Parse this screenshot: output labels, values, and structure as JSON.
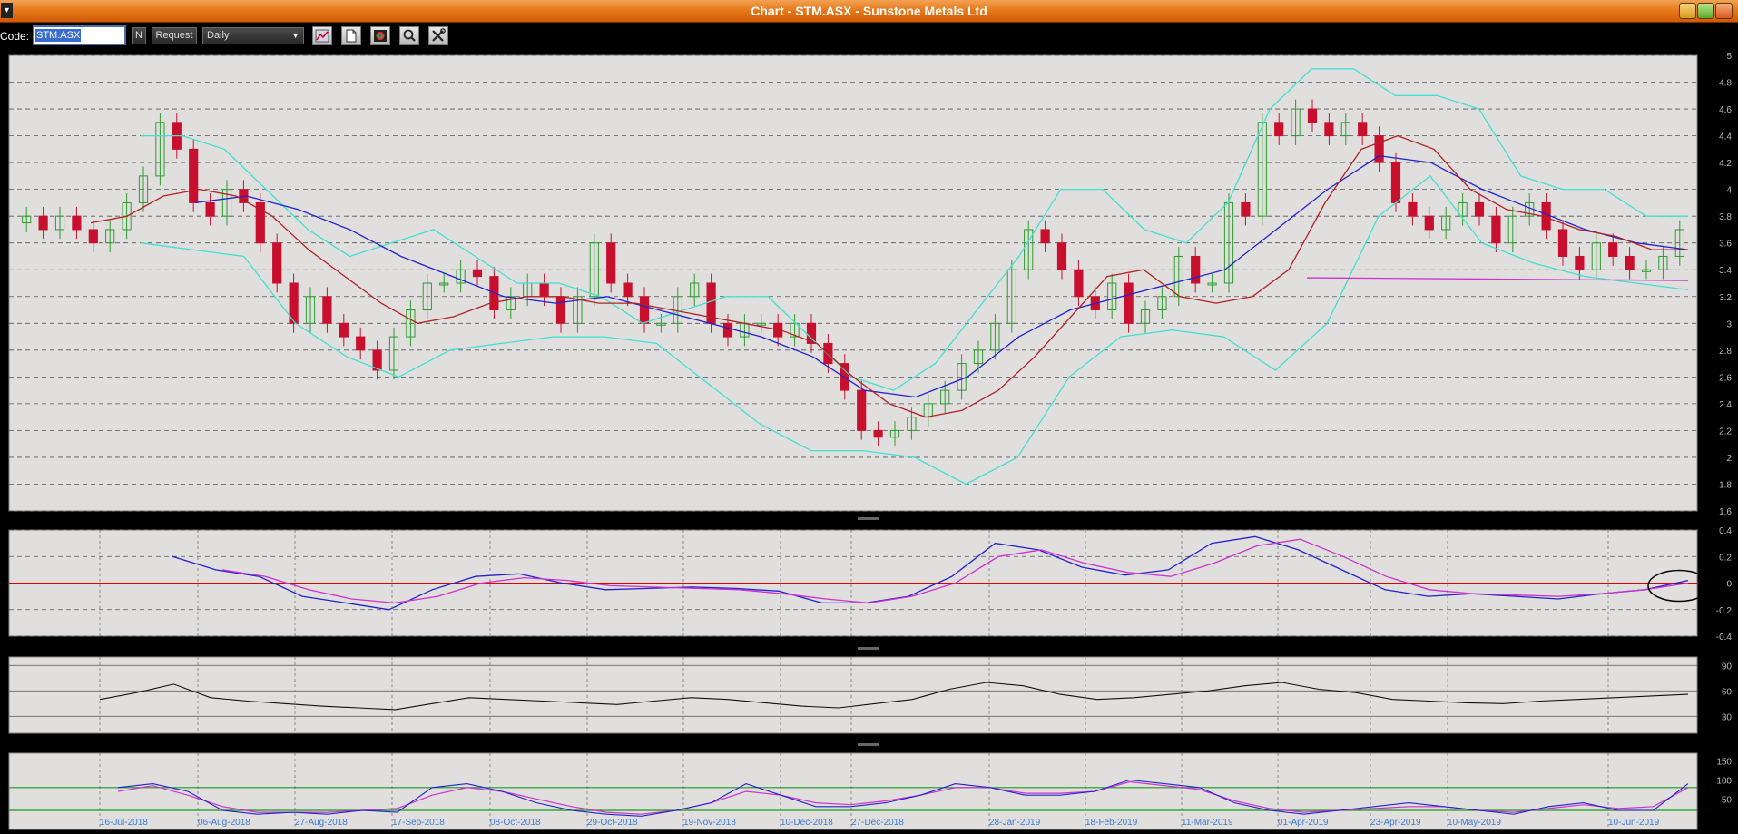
{
  "window": {
    "title": "Chart - STM.ASX - Sunstone Metals Ltd",
    "menu_glyph": "▾"
  },
  "toolbar": {
    "code_label": "Code:",
    "code_value": "STM.ASX",
    "n_label": "N",
    "request_label": "Request",
    "period_selected": "Daily",
    "icons": [
      "chart-style-icon",
      "new-document-icon",
      "color-palette-icon",
      "zoom-icon",
      "tools-icon"
    ]
  },
  "colors": {
    "up_candle": "#2e9b2e",
    "down_candle": "#c8102e",
    "sma_fast": "#b22222",
    "sma_slow": "#2222cc",
    "bollinger": "#40e0d0",
    "support": "#cc33cc",
    "macd": "#2222cc",
    "macd_signal": "#cc33cc",
    "zero_line": "#dd0000",
    "panel_bg": "#e1dede"
  },
  "chart_data": [
    {
      "type": "candlestick",
      "title": "",
      "x_tick_labels": [
        "16-Jul-2018",
        "06-Aug-2018",
        "27-Aug-2018",
        "17-Sep-2018",
        "08-Oct-2018",
        "29-Oct-2018",
        "19-Nov-2018",
        "10-Dec-2018",
        "27-Dec-2018",
        "28-Jan-2019",
        "18-Feb-2019",
        "11-Mar-2019",
        "01-Apr-2019",
        "23-Apr-2019",
        "10-May-2019",
        "10-Jun-2019"
      ],
      "y_ticks": [
        "1.6",
        "1.8",
        "2",
        "2.2",
        "2.4",
        "2.6",
        "2.8",
        "3",
        "3.2",
        "3.4",
        "3.6",
        "3.8",
        "4",
        "4.2",
        "4.4",
        "4.6",
        "4.8",
        "5"
      ],
      "ylim": [
        1.6,
        5.0
      ],
      "close_path": [
        3.8,
        3.7,
        3.8,
        3.7,
        3.6,
        3.7,
        3.9,
        4.1,
        4.5,
        4.3,
        3.9,
        3.8,
        4.0,
        3.9,
        3.6,
        3.3,
        3.0,
        3.2,
        3.0,
        2.9,
        2.8,
        2.65,
        2.9,
        3.1,
        3.3,
        3.3,
        3.4,
        3.35,
        3.1,
        3.2,
        3.3,
        3.2,
        3.0,
        3.2,
        3.6,
        3.3,
        3.2,
        3.0,
        3.0,
        3.2,
        3.3,
        3.0,
        2.9,
        3.0,
        3.0,
        2.9,
        3.0,
        2.85,
        2.7,
        2.5,
        2.2,
        2.15,
        2.2,
        2.3,
        2.4,
        2.5,
        2.7,
        2.8,
        3.0,
        3.4,
        3.7,
        3.6,
        3.4,
        3.2,
        3.1,
        3.3,
        3.0,
        3.1,
        3.2,
        3.5,
        3.3,
        3.3,
        3.9,
        3.8,
        4.5,
        4.4,
        4.6,
        4.5,
        4.4,
        4.5,
        4.4,
        4.2,
        3.9,
        3.8,
        3.7,
        3.8,
        3.9,
        3.8,
        3.6,
        3.8,
        3.9,
        3.7,
        3.5,
        3.4,
        3.6,
        3.5,
        3.4,
        3.4,
        3.5,
        3.7
      ],
      "sma_fast_path": [
        3.75,
        3.8,
        3.95,
        4.0,
        3.95,
        3.8,
        3.55,
        3.35,
        3.15,
        3.0,
        3.05,
        3.15,
        3.2,
        3.2,
        3.15,
        3.15,
        3.1,
        3.05,
        3.0,
        2.95,
        2.85,
        2.6,
        2.4,
        2.3,
        2.35,
        2.5,
        2.75,
        3.05,
        3.35,
        3.4,
        3.2,
        3.15,
        3.2,
        3.4,
        3.9,
        4.3,
        4.4,
        4.3,
        4.0,
        3.85,
        3.8,
        3.7,
        3.65,
        3.55,
        3.55
      ],
      "sma_slow_path": [
        3.9,
        3.95,
        3.85,
        3.7,
        3.5,
        3.35,
        3.2,
        3.15,
        3.2,
        3.1,
        3.0,
        2.9,
        2.75,
        2.5,
        2.45,
        2.6,
        2.9,
        3.1,
        3.2,
        3.3,
        3.4,
        3.7,
        4.0,
        4.25,
        4.2,
        4.0,
        3.85,
        3.7,
        3.6,
        3.55
      ],
      "bollinger_upper_path": [
        4.4,
        4.4,
        4.3,
        4.0,
        3.7,
        3.5,
        3.6,
        3.7,
        3.5,
        3.3,
        3.3,
        3.2,
        3.0,
        3.1,
        3.2,
        3.2,
        2.9,
        2.6,
        2.5,
        2.7,
        3.1,
        3.5,
        4.0,
        4.0,
        3.7,
        3.6,
        3.9,
        4.6,
        4.9,
        4.9,
        4.7,
        4.7,
        4.6,
        4.1,
        4.0,
        4.0,
        3.8,
        3.8
      ],
      "bollinger_lower_path": [
        3.6,
        3.55,
        3.5,
        3.0,
        2.75,
        2.6,
        2.8,
        2.85,
        2.9,
        2.9,
        2.85,
        2.55,
        2.25,
        2.05,
        2.05,
        2.0,
        1.8,
        2.0,
        2.6,
        2.9,
        2.95,
        2.9,
        2.65,
        3.0,
        3.8,
        4.1,
        3.6,
        3.45,
        3.35,
        3.3,
        3.25
      ],
      "support_level": 3.32
    },
    {
      "type": "line",
      "y_ticks": [
        "0.4",
        "0.2",
        "0",
        "-0.2",
        "-0.4"
      ],
      "ylim": [
        -0.4,
        0.4
      ],
      "macd_path": [
        0.2,
        0.1,
        0.05,
        -0.1,
        -0.15,
        -0.2,
        -0.05,
        0.05,
        0.07,
        0.0,
        -0.05,
        -0.04,
        -0.03,
        -0.04,
        -0.06,
        -0.15,
        -0.15,
        -0.1,
        0.05,
        0.3,
        0.25,
        0.12,
        0.06,
        0.1,
        0.3,
        0.35,
        0.25,
        0.1,
        -0.05,
        -0.1,
        -0.08,
        -0.1,
        -0.12,
        -0.08,
        -0.05,
        0.02
      ],
      "signal_path": [
        0.1,
        0.05,
        -0.05,
        -0.12,
        -0.15,
        -0.1,
        0.0,
        0.04,
        0.02,
        -0.02,
        -0.03,
        -0.04,
        -0.05,
        -0.08,
        -0.12,
        -0.15,
        -0.1,
        0.0,
        0.2,
        0.25,
        0.15,
        0.08,
        0.05,
        0.15,
        0.28,
        0.33,
        0.2,
        0.05,
        -0.05,
        -0.08,
        -0.09,
        -0.1,
        -0.08,
        -0.05,
        0.0
      ]
    },
    {
      "type": "line",
      "y_ticks": [
        "90",
        "60",
        "30"
      ],
      "ylim": [
        10,
        100
      ],
      "rsi_path": [
        50,
        58,
        68,
        52,
        48,
        45,
        42,
        40,
        38,
        45,
        52,
        50,
        48,
        46,
        44,
        48,
        52,
        50,
        46,
        42,
        40,
        45,
        50,
        62,
        70,
        66,
        56,
        50,
        52,
        56,
        60,
        66,
        70,
        62,
        58,
        50,
        48,
        46,
        45,
        48,
        50,
        52,
        54,
        56
      ]
    },
    {
      "type": "line",
      "y_ticks": [
        "150",
        "100",
        "50"
      ],
      "ylim": [
        -30,
        170
      ],
      "stoch_k_path": [
        80,
        90,
        70,
        20,
        10,
        15,
        10,
        20,
        15,
        80,
        90,
        70,
        40,
        20,
        10,
        5,
        20,
        40,
        90,
        60,
        30,
        30,
        40,
        60,
        90,
        80,
        60,
        60,
        70,
        100,
        90,
        80,
        40,
        20,
        10,
        20,
        30,
        40,
        30,
        20,
        10,
        30,
        40,
        20,
        20,
        90
      ],
      "stoch_d_path": [
        70,
        85,
        60,
        30,
        15,
        15,
        15,
        20,
        25,
        60,
        80,
        70,
        50,
        30,
        15,
        10,
        20,
        40,
        70,
        60,
        40,
        35,
        45,
        60,
        80,
        80,
        65,
        65,
        70,
        95,
        85,
        75,
        45,
        25,
        15,
        20,
        25,
        30,
        30,
        20,
        15,
        25,
        35,
        25,
        30,
        80
      ],
      "overbought": 80,
      "oversold": 20
    }
  ]
}
